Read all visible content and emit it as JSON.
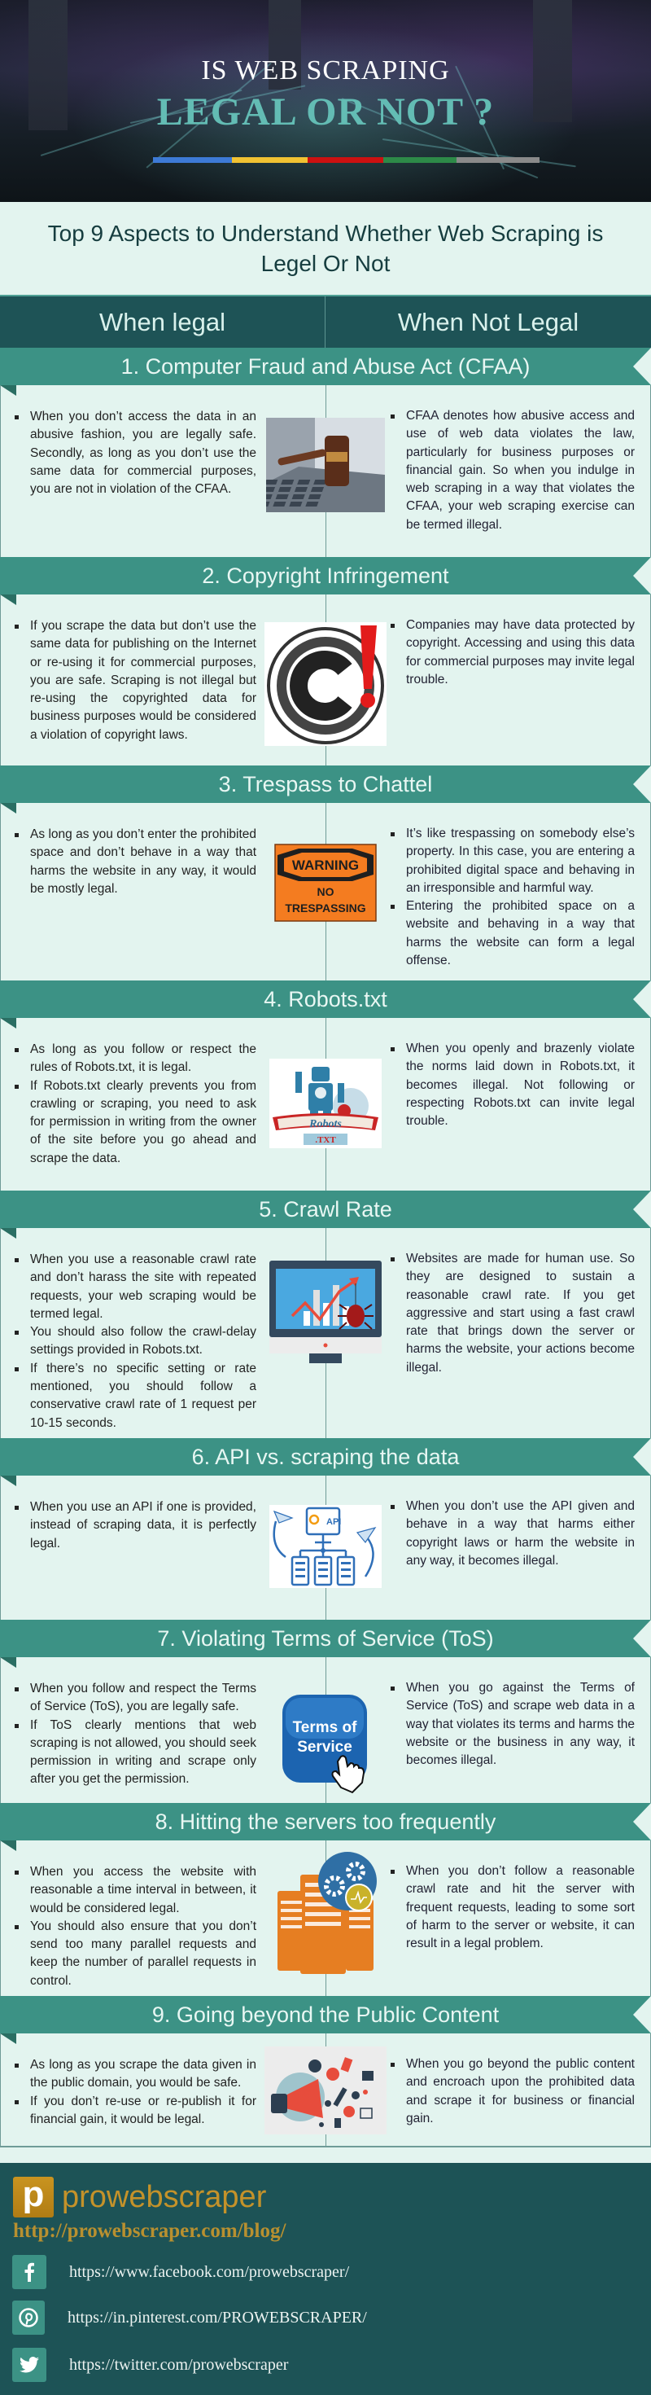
{
  "hero": {
    "line1": "IS WEB SCRAPING",
    "line2": "LEGAL OR NOT ?",
    "color_bar": [
      "#3d7ad6",
      "#f1c232",
      "#cc1111",
      "#2d8a48",
      "#8a8a8a"
    ]
  },
  "subtitle": "Top 9 Aspects to Understand Whether Web Scraping is Legel Or Not",
  "columns": {
    "left": "When legal",
    "right": "When Not Legal"
  },
  "colors": {
    "header_dark": "#1e5356",
    "ribbon": "#3c9285",
    "background": "#e3f4ef",
    "brand_gold": "#c4922a"
  },
  "sections": [
    {
      "title": "1. Computer Fraud and Abuse Act (CFAA)",
      "illustration": "gavel-on-laptop-icon",
      "legal": [
        "When you don’t access the data in an abusive fashion, you are legally safe. Secondly, as long as you don’t use the same data for commercial purposes, you are not in violation of the CFAA."
      ],
      "not_legal": [
        "CFAA denotes how abusive access and use of web data violates the law, particularly for business purposes or financial gain. So when you indulge in web scraping in a way that violates the CFAA, your web scraping exercise can be termed illegal."
      ]
    },
    {
      "title": "2. Copyright Infringement",
      "illustration": "copyright-warning-icon",
      "legal": [
        "If you scrape the data but don’t use the same data for publishing on the Internet or re-using it for commercial purposes, you are safe. Scraping is not illegal but re-using the copyrighted data for business purposes would be considered a violation of copyright laws."
      ],
      "not_legal": [
        "Companies may have data protected by copyright. Accessing and using this data for commercial purposes may invite legal trouble."
      ]
    },
    {
      "title": "3. Trespass to Chattel",
      "illustration": "no-trespassing-sign-icon",
      "sign": {
        "top": "WARNING",
        "bottom1": "NO",
        "bottom2": "TRESPASSING"
      },
      "legal": [
        "As long as you don’t enter the prohibited space and don’t behave in a way that harms the website in any way, it would be mostly legal."
      ],
      "not_legal": [
        "It’s like trespassing on somebody else’s property. In this case, you are entering a prohibited digital space and behaving in an irresponsible and harmful way.",
        "Entering the prohibited space on a website and behaving in a way that harms the website can form a legal offense."
      ]
    },
    {
      "title": "4. Robots.txt",
      "illustration": "robot-icon",
      "robot_label": {
        "name": "Robots",
        "ext": ".TXT"
      },
      "legal": [
        "As long as you follow or respect the rules of Robots.txt, it is legal.",
        "If Robots.txt clearly prevents you from crawling or scraping, you need to ask for permission in writing from the owner of the site before you go ahead and scrape the data."
      ],
      "not_legal": [
        "When you openly and brazenly violate the norms laid down in Robots.txt, it becomes illegal. Not following or respecting Robots.txt can invite legal trouble."
      ]
    },
    {
      "title": "5. Crawl Rate",
      "illustration": "monitor-chart-spider-icon",
      "legal": [
        "When you use a reasonable crawl rate and don’t harass the site with repeated requests, your web scraping would be termed legal.",
        "You should also follow the crawl-delay settings provided in Robots.txt.",
        "If there’s no specific setting or rate mentioned, you should follow a conservative crawl rate of 1 request per 10-15 seconds."
      ],
      "not_legal": [
        "Websites are made for human use. So they are designed to sustain a reasonable crawl rate. If you get aggressive and start using a fast crawl rate that brings down the server or harms the website, your actions become illegal."
      ]
    },
    {
      "title": "6. API vs. scraping the data",
      "illustration": "api-network-icon",
      "api_label": "API",
      "legal": [
        "When you use an API if one is provided, instead of scraping data, it is perfectly legal."
      ],
      "not_legal": [
        "When you don’t use the API given and behave in a way that harms either copyright laws or harm the website in any way, it becomes illegal."
      ]
    },
    {
      "title": "7. Violating Terms of Service (ToS)",
      "illustration": "terms-of-service-button-icon",
      "tos_label": "Terms of Service",
      "legal": [
        "When you follow and respect the Terms of Service (ToS), you are legally safe.",
        "If ToS clearly mentions that web scraping is not allowed, you should seek permission in writing and scrape only after you get the permission."
      ],
      "not_legal": [
        "When you go against the Terms of Service (ToS) and scrape web data in a way that violates its terms and harms the website or the business in any way, it becomes illegal."
      ]
    },
    {
      "title": "8. Hitting the servers too frequently",
      "illustration": "servers-gears-icon",
      "legal": [
        "When you access the website with reasonable a time interval in between, it would be considered legal.",
        "You should also ensure that you don’t send too many parallel requests and keep the number of parallel requests in control."
      ],
      "not_legal": [
        "When you don’t follow a reasonable crawl rate and hit the server with frequent requests, leading to some sort of harm to the server or website, it can result in a legal problem."
      ]
    },
    {
      "title": "9. Going beyond the Public Content",
      "illustration": "megaphone-icons-cloud-icon",
      "legal": [
        "As long as you scrape the data given in the public domain, you would be safe.",
        "If you don’t re-use or re-publish it for financial gain, it would be legal."
      ],
      "not_legal": [
        "When you go beyond the public content and encroach upon the prohibited data and scrape it for business or financial gain."
      ]
    }
  ],
  "footer": {
    "logo_letter": "p",
    "brand": "prowebscraper",
    "blog_url": "http://prowebscraper.com/blog/",
    "social": [
      {
        "icon": "facebook-icon",
        "glyph": "f",
        "url": "https://www.facebook.com/prowebscraper/"
      },
      {
        "icon": "pinterest-icon",
        "glyph": "P",
        "url": "https://in.pinterest.com/PROWEBSCRAPER/"
      },
      {
        "icon": "twitter-icon",
        "glyph": "t",
        "url": "https://twitter.com/prowebscraper"
      }
    ]
  }
}
